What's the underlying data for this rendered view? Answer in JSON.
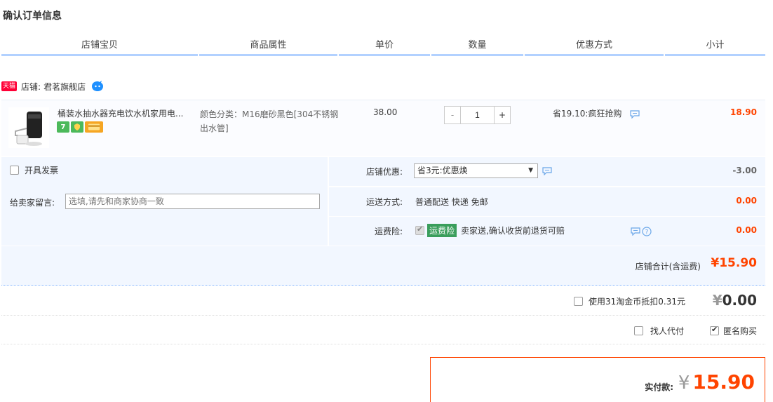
{
  "page_title": "确认订单信息",
  "columns": [
    "店铺宝贝",
    "商品属性",
    "单价",
    "数量",
    "优惠方式",
    "小计"
  ],
  "shop": {
    "badge": "天猫",
    "label": "店铺:",
    "name": "君茗旗舰店"
  },
  "item": {
    "title": "桶装水抽水器充电饮水机家用电...",
    "props": "颜色分类：M16磨砂黑色[304不锈钢出水管]",
    "unit_price": "38.00",
    "quantity": "1",
    "qty_minus": "-",
    "qty_plus": "+",
    "promo": "省19.10:疯狂抢购",
    "subtotal": "18.90"
  },
  "options": {
    "invoice_label": "开具发票",
    "remark_label": "给卖家留言:",
    "remark_placeholder": "选填,请先和商家协商一致",
    "shop_discount_label": "店铺优惠:",
    "shop_discount_selected": "省3元:优惠焕",
    "shop_discount_amount": "-3.00",
    "shipping_label": "运送方式:",
    "shipping_value": "普通配送 快递 免邮",
    "shipping_amount": "0.00",
    "insurance_label": "运费险:",
    "insurance_tag": "运费险",
    "insurance_text": "卖家送,确认收货前退货可赔",
    "insurance_amount": "0.00"
  },
  "shop_total": {
    "label": "店铺合计(含运费)",
    "amount": "¥15.90"
  },
  "coins": {
    "text": "使用31淘金币抵扣0.31元",
    "yen": "¥",
    "amount": "0.00"
  },
  "buy_options": {
    "proxy_label": "找人代付",
    "anonymous_label": "匿名购买"
  },
  "payment": {
    "label": "实付款:",
    "yen": "¥",
    "amount": "15.90"
  },
  "colors": {
    "accent_red": "#ff4400",
    "header_blue": "#b2d1ff",
    "row_bg": "#f2f7ff",
    "insurance_green": "#3a9e5c"
  }
}
